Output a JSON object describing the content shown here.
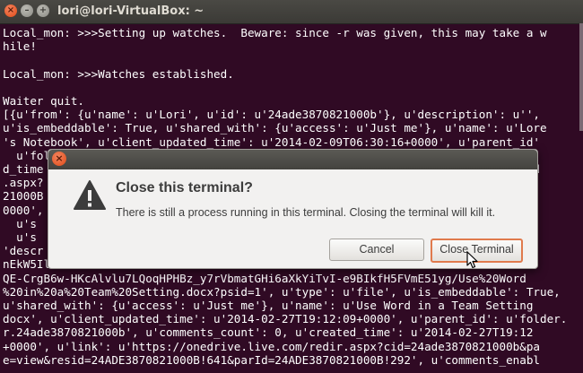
{
  "window": {
    "title": "lori@lori-VirtualBox: ~",
    "close_glyph": "×",
    "min_glyph": "–",
    "max_glyph": "+"
  },
  "terminal": {
    "lines": [
      "Local_mon: >>>Setting up watches.  Beware: since -r was given, this may take a w",
      "hile!",
      "",
      "Local_mon: >>>Watches established.",
      "",
      "Waiter quit.",
      "[{u'from': {u'name': u'Lori', u'id': u'24ade3870821000b'}, u'description': u'',",
      "u'is_embeddable': True, u'shared_with': {u'access': u'Just me'}, u'name': u'Lore",
      "'s Notebook', u'client_updated_time': u'2014-02-09T06:30:16+0000', u'parent_id'",
      "  u'folde",
      "d_time                                                                  created",
      ".aspx?                                                                 /redir",
      "21000B                                                                 E38708",
      "0000',                                                                 :00+",
      "  u's                                                                  B!298'",
      "  u's                                                                 enable",
      "'descr                                                                2m2J9s0",
      "nEkW5Il                                                               -ofoYo",
      "QE-CrgB6w-HKcAlvlu7LQoqHPHBz_y7rVbmatGHi6aXkYiTvI-e9BIkfH5FVmE51yg/Use%20Word",
      "%20in%20a%20Team%20Setting.docx?psid=1', u'type': u'file', u'is_embeddable': True,",
      "u'shared_with': {u'access': u'Just me'}, u'name': u'Use Word in a Team Setting",
      "docx', u'client_updated_time': u'2014-02-27T19:12:09+0000', u'parent_id': u'folder.",
      "r.24ade3870821000b', u'comments_count': 0, u'created_time': u'2014-02-27T19:12",
      "+0000', u'link': u'https://onedrive.live.com/redir.aspx?cid=24ade3870821000b&pa",
      "e=view&resid=24ADE3870821000B!641&parId=24ADE3870821000B!292', u'comments_enabl"
    ]
  },
  "dialog": {
    "title": "Close this terminal?",
    "message": "There is still a process running in this terminal. Closing the terminal will kill it.",
    "cancel_label": "Cancel",
    "confirm_label": "Close Terminal",
    "close_glyph": "×"
  },
  "colors": {
    "terminal_bg": "#300a24",
    "accent": "#e07a4d"
  }
}
